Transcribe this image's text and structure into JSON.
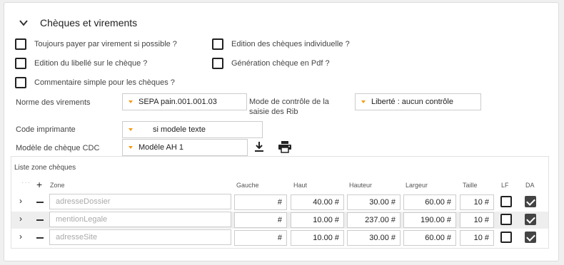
{
  "section": {
    "title": "Chèques et virements"
  },
  "options": [
    {
      "label": "Toujours payer par virement si possible ?",
      "checked": false
    },
    {
      "label": "Edition des chèques individuelle ?",
      "checked": false
    },
    {
      "label": "Edition du libellé sur le chèque ?",
      "checked": false
    },
    {
      "label": "Génération chèque en Pdf ?",
      "checked": false
    },
    {
      "label": "Commentaire simple pour les chèques ?",
      "checked": false
    }
  ],
  "fields": {
    "norme_label": "Norme des virements",
    "norme_value": "SEPA pain.001.001.03",
    "mode_label": "Mode de contrôle de la saisie des Rib",
    "mode_value": "Liberté : aucun contrôle",
    "code_label": "Code imprimante",
    "code_value": "si modele texte",
    "modele_label": "Modèle de chèque CDC",
    "modele_value": "Modèle AH 1"
  },
  "icons": {
    "download": "download-icon",
    "print": "printer-icon",
    "accent": "#f39c12"
  },
  "zones": {
    "title": "Liste zone chèques",
    "add_symbol": "+",
    "headers": {
      "zone": "Zone",
      "gauche": "Gauche",
      "haut": "Haut",
      "hauteur": "Hauteur",
      "largeur": "Largeur",
      "taille": "Taille",
      "lf": "LF",
      "da": "DA"
    },
    "rows": [
      {
        "zone": "adresseDossier",
        "gauche": "#",
        "haut": "40.00 #",
        "hauteur": "30.00 #",
        "largeur": "60.00 #",
        "taille": "10 #",
        "lf": false,
        "da": true
      },
      {
        "zone": "mentionLegale",
        "gauche": "#",
        "haut": "10.00 #",
        "hauteur": "237.00 #",
        "largeur": "190.00 #",
        "taille": "10 #",
        "lf": false,
        "da": true
      },
      {
        "zone": "adresseSite",
        "gauche": "#",
        "haut": "10.00 #",
        "hauteur": "30.00 #",
        "largeur": "60.00 #",
        "taille": "10 #",
        "lf": false,
        "da": true
      }
    ]
  }
}
